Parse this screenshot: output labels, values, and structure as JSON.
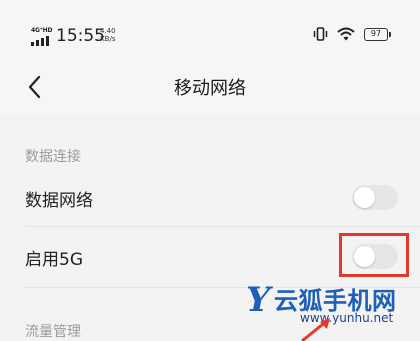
{
  "status_bar": {
    "network_tag": "4G⁺HD",
    "time": "15:55",
    "speed_value": "4.40",
    "speed_unit": "KB/s",
    "battery": "97",
    "icons": [
      "signal-icon",
      "vibrate-icon",
      "wifi-icon",
      "battery-icon"
    ]
  },
  "header": {
    "title": "移动网络",
    "back_icon": "chevron-left-icon"
  },
  "sections": [
    {
      "title": "数据连接",
      "items": [
        {
          "label": "数据网络",
          "toggle": false
        },
        {
          "label": "启用5G",
          "toggle": false
        }
      ]
    },
    {
      "title": "流量管理"
    }
  ],
  "colors": {
    "background": "#f3f3f3",
    "highlight_box": "#e13a2b",
    "toggle_off": "#e6e6e6",
    "watermark": "#1f5fb8"
  },
  "watermark": {
    "letter": "Y",
    "brand": "云狐手机网",
    "url": "www.yunhu.net"
  }
}
